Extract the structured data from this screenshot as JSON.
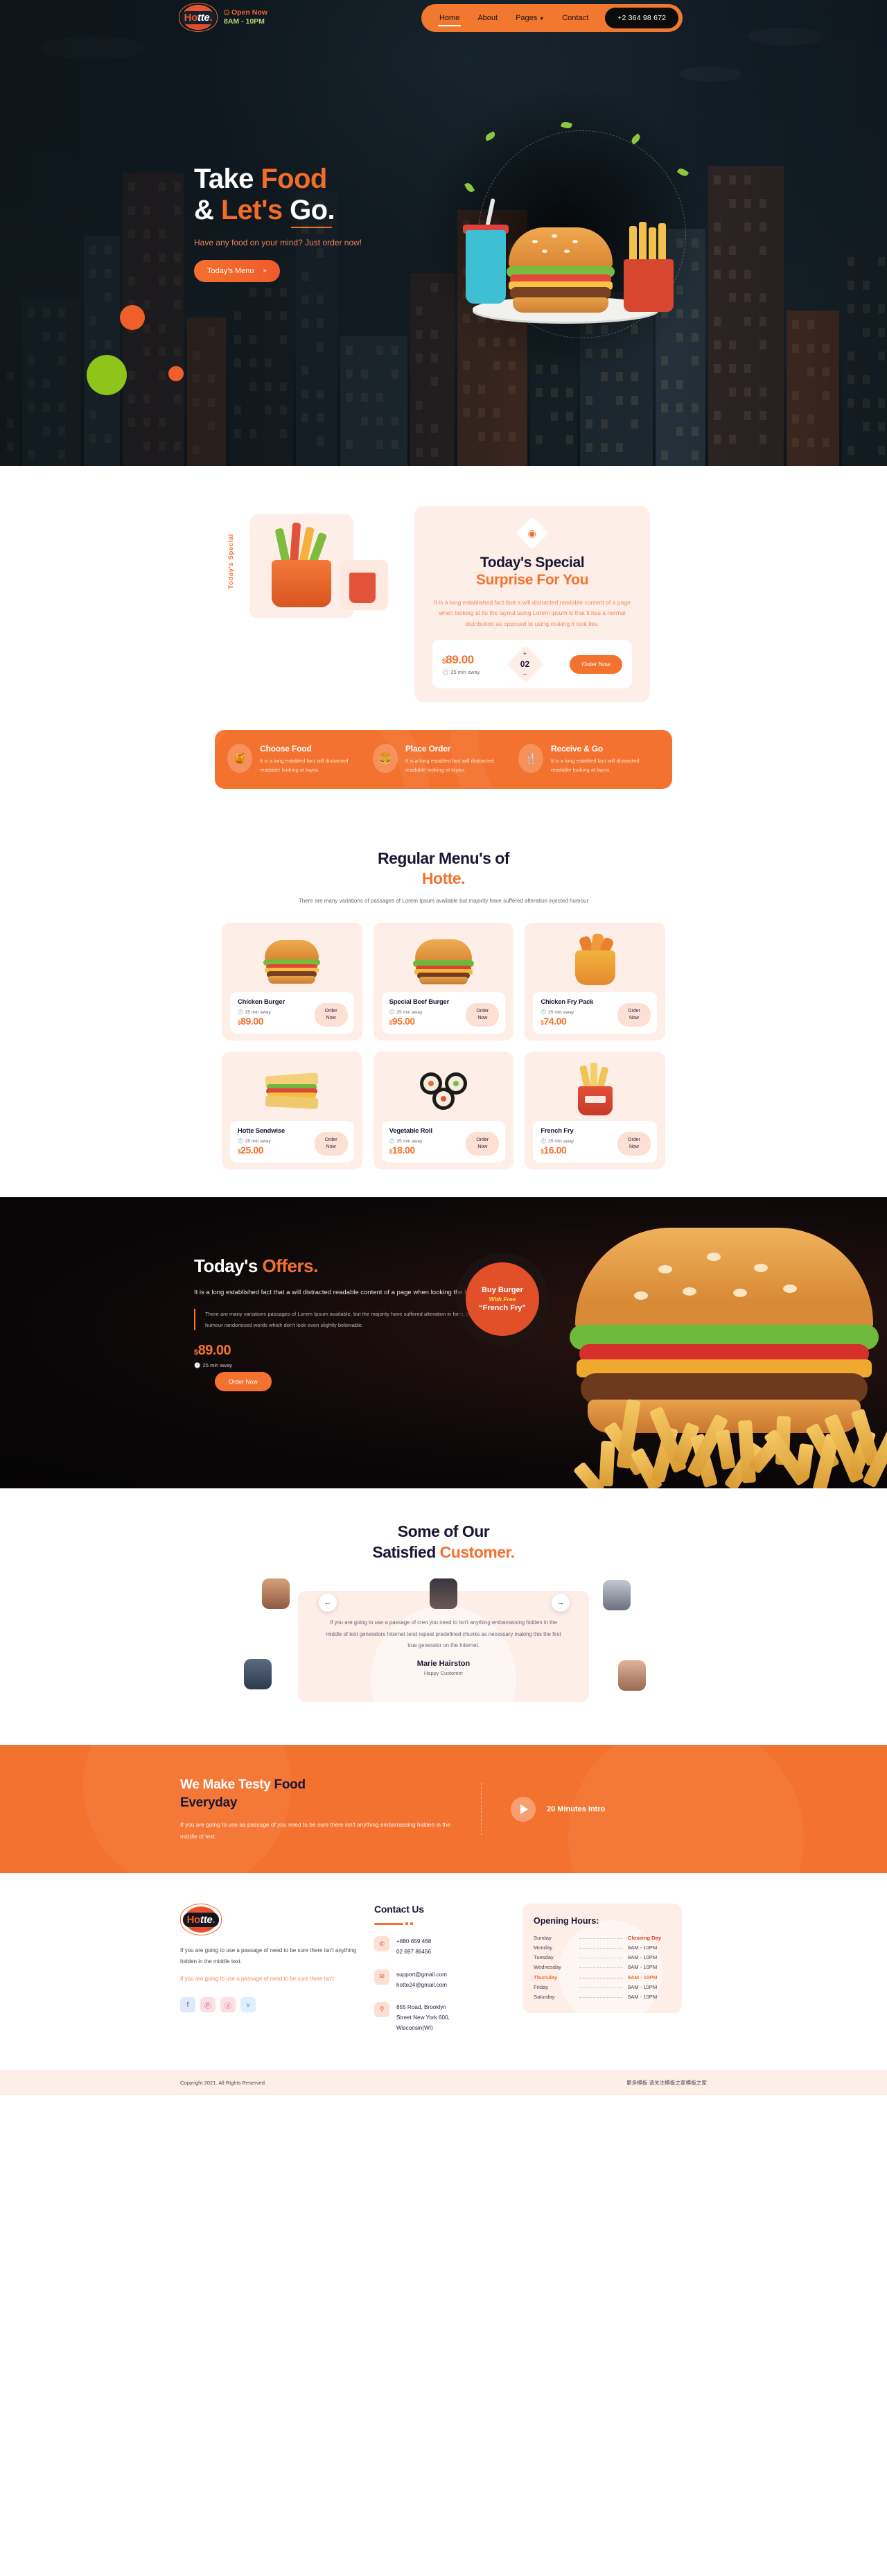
{
  "nav": {
    "logo_text_1": "Ho",
    "logo_text_2": "tte",
    "logo_text_3": ".",
    "open_status": "Open Now",
    "open_hours": "8AM - 10PM",
    "items": [
      {
        "label": "Home",
        "active": true
      },
      {
        "label": "About",
        "active": false
      },
      {
        "label": "Pages",
        "active": false,
        "caret": true
      },
      {
        "label": "Contact",
        "active": false
      }
    ],
    "phone": "+2 364 98 672"
  },
  "hero": {
    "title_1": "Take ",
    "title_2": "Food",
    "title_3": "& ",
    "title_4": "Let's ",
    "title_5": "Go.",
    "subtitle": "Have any food on your mind?",
    "subtitle_accent": "Just order now!",
    "cta_label": "Today's Menu",
    "cta_chevron": "»"
  },
  "special": {
    "side_tag": "Today's Special",
    "badge_icon": "donut-icon",
    "title": "Today's Special",
    "title_accent": "Surprise For You",
    "desc_main": "It is a long established fact that a will distracted readable content of a page when looking at its the layout using Lorem ipsum is that it has a normal distribution ",
    "desc_accent": "as opposed to using making it look like.",
    "currency": "$",
    "price": "89.00",
    "away": "25 min away",
    "qty_plus": "+",
    "qty_value": "02",
    "qty_minus": "–",
    "order_label": "Order Now"
  },
  "steps": [
    {
      "icon": "food-jar-icon",
      "title": "Choose Food",
      "desc": "It is a long establed fact will distracted readable looking at layou."
    },
    {
      "icon": "burger-box-icon",
      "title": "Place Order",
      "desc": "It is a long establed fact will distracted readable looking at layou."
    },
    {
      "icon": "fork-cutlery-icon",
      "title": "Receive & Go",
      "desc": "It is a long establed fact will distracted readable looking at layou."
    }
  ],
  "menu": {
    "title": "Regular Menu's of",
    "title_accent": "Hotte.",
    "subtitle": "There are many variations of passages of Lorem Ipsum available but majority have suffered alteration injected humour",
    "currency": "$",
    "order_line1": "Order",
    "order_line2": "Now",
    "items": [
      {
        "name": "Chicken Burger",
        "away": "25 min away",
        "price": "89.00",
        "art": "burger"
      },
      {
        "name": "Special Beef Burger",
        "away": "25 min away",
        "price": "95.00",
        "art": "burger2"
      },
      {
        "name": "Chicken Fry Pack",
        "away": "25 min away",
        "price": "74.00",
        "art": "frypack"
      },
      {
        "name": "Hotte Sendwise",
        "away": "25 min away",
        "price": "25.00",
        "art": "sandwich"
      },
      {
        "name": "Vegetable Roll",
        "away": "25 min away",
        "price": "18.00",
        "art": "roll"
      },
      {
        "name": "French Fry",
        "away": "25 min away",
        "price": "16.00",
        "art": "frenchfry"
      }
    ]
  },
  "offers": {
    "title": "Today's ",
    "title_accent": "Offers.",
    "lead": "It is a long established fact that a will distracted readable content of a page when looking the layout",
    "quote": "There are many variations passages of Lorem Ipsum available, but the majority have suffered alteration in form, by injected humour randomised words which don't look even slightly believable.",
    "currency": "$",
    "price": "89.00",
    "away": "25 min away",
    "order_label": "Order Now",
    "badge_line1": "Buy Burger",
    "badge_line2": "With Free",
    "badge_line3": "“French Fry”"
  },
  "testimonials": {
    "title_1": "Some of Our",
    "title_2": "Satisfied ",
    "title_accent": "Customer.",
    "prev_icon": "arrow-left-icon",
    "next_icon": "arrow-right-icon",
    "quote": "If you are going to use a passage of cren you need to isn't anything embarrassing hidden in the middle of text generators Internet tend repeat predefined chunks as necessary making this the first true generator on the Internet.",
    "name": "Marie Hairston",
    "role": "Happy Customer"
  },
  "cta": {
    "title_1": "We Make Testy ",
    "title_2": "Food",
    "title_3": "Everyday",
    "desc": "If you are going to use aa passage of you need to be sure there isn't anything embarrassing hidden in the middle of text.",
    "play_icon": "play-icon",
    "video_label": "20 Minutes Intro"
  },
  "footer": {
    "logo_text_1": "Ho",
    "logo_text_2": "tte",
    "logo_text_3": ".",
    "about": "If you are going to use a passage of need to be sure there isn't anything hidden in the middle text.",
    "about_alt": "If you are going to use a passage of need to be sure there isn't",
    "socials": [
      {
        "name": "facebook-icon",
        "glyph": "f"
      },
      {
        "name": "pinterest-icon",
        "glyph": "Ⓟ"
      },
      {
        "name": "dribbble-icon",
        "glyph": "ⓓ"
      },
      {
        "name": "twitter-icon",
        "glyph": "ᴠ"
      }
    ],
    "contact_title": "Contact Us",
    "contacts": [
      {
        "icon": "phone-icon",
        "line1": "+880 659 468",
        "line2": "02 697 86456"
      },
      {
        "icon": "mail-icon",
        "line1": "support@gmail.com",
        "line2": "hotte24@gmail.com"
      },
      {
        "icon": "location-icon",
        "line1": "855 Road, Brooklyn",
        "line2": "Street New York 600,",
        "line3": "Wisconsin(WI)"
      }
    ],
    "hours_title": "Opening Hours:",
    "hours": [
      {
        "day": "Sunday",
        "time": "Closeing Day",
        "closed": true,
        "highlight": false
      },
      {
        "day": "Monday",
        "time": "8AM - 10PM",
        "closed": false,
        "highlight": false
      },
      {
        "day": "Tuesday",
        "time": "8AM - 10PM",
        "closed": false,
        "highlight": false
      },
      {
        "day": "Wednesday",
        "time": "8AM - 10PM",
        "closed": false,
        "highlight": false
      },
      {
        "day": "Thursday",
        "time": "8AM - 10PM",
        "closed": false,
        "highlight": true
      },
      {
        "day": "Friday",
        "time": "8AM - 10PM",
        "closed": false,
        "highlight": false
      },
      {
        "day": "Saturday",
        "time": "8AM - 10PM",
        "closed": false,
        "highlight": false
      }
    ],
    "copyright": "Copyright 2021. All Rights Reserved.",
    "credit": "更多模板 请关注模板之家模板之家"
  },
  "colors": {
    "accent": "#f4722f",
    "accent_dark": "#e2502a",
    "dark": "#1b1733",
    "soft_bg": "#fdeee8"
  }
}
